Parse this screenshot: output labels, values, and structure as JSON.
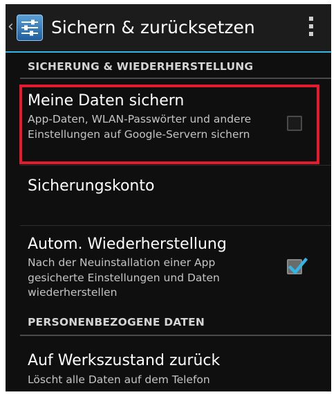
{
  "action_bar": {
    "title": "Sichern & zurücksetzen",
    "up_glyph": "‹",
    "icon": "settings-sliders-icon",
    "overflow_icon": "overflow-menu-icon",
    "accent_color": "#33b5e5"
  },
  "sections": {
    "backup": {
      "header": "SICHERUNG & WIEDERHERSTELLUNG"
    },
    "personal": {
      "header": "PERSONENBEZOGENE DATEN"
    }
  },
  "items": {
    "backup_data": {
      "title": "Meine Daten sichern",
      "summary": "App-Daten, WLAN-Passwörter und andere Einstellungen auf Google-Servern sichern",
      "checked": false
    },
    "backup_account": {
      "title": "Sicherungskonto"
    },
    "auto_restore": {
      "title": "Autom. Wiederherstellung",
      "summary": "Nach der Neuinstallation einer App gesicherte Einstellungen und Daten wiederherstellen",
      "checked": true,
      "check_color": "#33b5e5"
    },
    "factory_reset": {
      "title": "Auf Werkszustand zurück",
      "summary": "Löscht alle Daten auf dem Telefon"
    }
  },
  "highlight_color": "#e31b2c"
}
